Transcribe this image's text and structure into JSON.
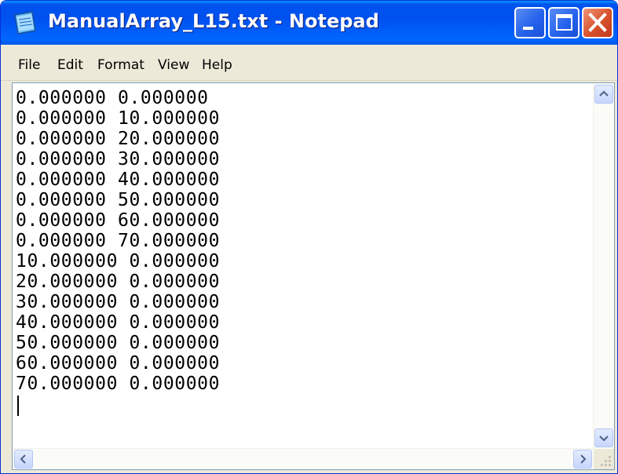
{
  "window": {
    "title": "ManualArray_L15.txt - Notepad",
    "icons": {
      "app": "notepad-icon",
      "minimize": "minimize-icon",
      "maximize": "maximize-icon",
      "close": "close-icon"
    },
    "colors": {
      "titlebar": "#0058e6",
      "close_button": "#d8512c",
      "chrome": "#ece9d8"
    }
  },
  "menu": {
    "file": "File",
    "edit": "Edit",
    "format": "Format",
    "view": "View",
    "help": "Help"
  },
  "document": {
    "lines": [
      "0.000000 0.000000",
      "0.000000 10.000000",
      "0.000000 20.000000",
      "0.000000 30.000000",
      "0.000000 40.000000",
      "0.000000 50.000000",
      "0.000000 60.000000",
      "0.000000 70.000000",
      "10.000000 0.000000",
      "20.000000 0.000000",
      "30.000000 0.000000",
      "40.000000 0.000000",
      "50.000000 0.000000",
      "60.000000 0.000000",
      "70.000000 0.000000"
    ]
  }
}
